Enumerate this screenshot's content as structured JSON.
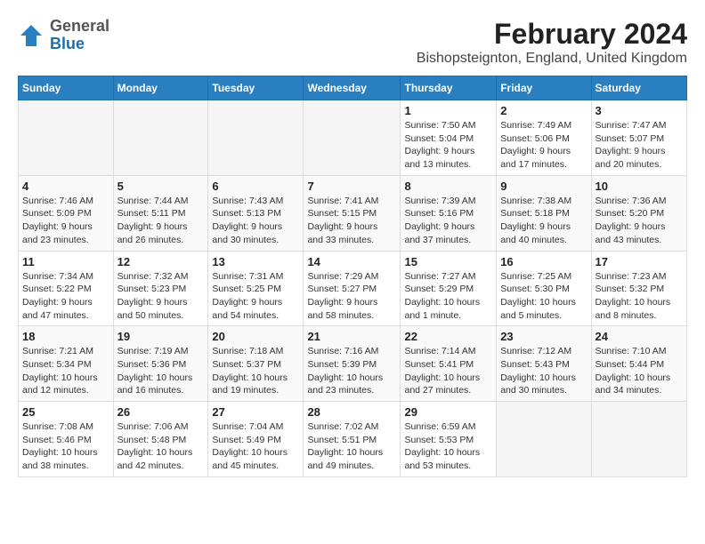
{
  "header": {
    "logo_general": "General",
    "logo_blue": "Blue",
    "month_year": "February 2024",
    "location": "Bishopsteignton, England, United Kingdom"
  },
  "calendar": {
    "days_of_week": [
      "Sunday",
      "Monday",
      "Tuesday",
      "Wednesday",
      "Thursday",
      "Friday",
      "Saturday"
    ],
    "weeks": [
      [
        {
          "day": "",
          "info": ""
        },
        {
          "day": "",
          "info": ""
        },
        {
          "day": "",
          "info": ""
        },
        {
          "day": "",
          "info": ""
        },
        {
          "day": "1",
          "info": "Sunrise: 7:50 AM\nSunset: 5:04 PM\nDaylight: 9 hours\nand 13 minutes."
        },
        {
          "day": "2",
          "info": "Sunrise: 7:49 AM\nSunset: 5:06 PM\nDaylight: 9 hours\nand 17 minutes."
        },
        {
          "day": "3",
          "info": "Sunrise: 7:47 AM\nSunset: 5:07 PM\nDaylight: 9 hours\nand 20 minutes."
        }
      ],
      [
        {
          "day": "4",
          "info": "Sunrise: 7:46 AM\nSunset: 5:09 PM\nDaylight: 9 hours\nand 23 minutes."
        },
        {
          "day": "5",
          "info": "Sunrise: 7:44 AM\nSunset: 5:11 PM\nDaylight: 9 hours\nand 26 minutes."
        },
        {
          "day": "6",
          "info": "Sunrise: 7:43 AM\nSunset: 5:13 PM\nDaylight: 9 hours\nand 30 minutes."
        },
        {
          "day": "7",
          "info": "Sunrise: 7:41 AM\nSunset: 5:15 PM\nDaylight: 9 hours\nand 33 minutes."
        },
        {
          "day": "8",
          "info": "Sunrise: 7:39 AM\nSunset: 5:16 PM\nDaylight: 9 hours\nand 37 minutes."
        },
        {
          "day": "9",
          "info": "Sunrise: 7:38 AM\nSunset: 5:18 PM\nDaylight: 9 hours\nand 40 minutes."
        },
        {
          "day": "10",
          "info": "Sunrise: 7:36 AM\nSunset: 5:20 PM\nDaylight: 9 hours\nand 43 minutes."
        }
      ],
      [
        {
          "day": "11",
          "info": "Sunrise: 7:34 AM\nSunset: 5:22 PM\nDaylight: 9 hours\nand 47 minutes."
        },
        {
          "day": "12",
          "info": "Sunrise: 7:32 AM\nSunset: 5:23 PM\nDaylight: 9 hours\nand 50 minutes."
        },
        {
          "day": "13",
          "info": "Sunrise: 7:31 AM\nSunset: 5:25 PM\nDaylight: 9 hours\nand 54 minutes."
        },
        {
          "day": "14",
          "info": "Sunrise: 7:29 AM\nSunset: 5:27 PM\nDaylight: 9 hours\nand 58 minutes."
        },
        {
          "day": "15",
          "info": "Sunrise: 7:27 AM\nSunset: 5:29 PM\nDaylight: 10 hours\nand 1 minute."
        },
        {
          "day": "16",
          "info": "Sunrise: 7:25 AM\nSunset: 5:30 PM\nDaylight: 10 hours\nand 5 minutes."
        },
        {
          "day": "17",
          "info": "Sunrise: 7:23 AM\nSunset: 5:32 PM\nDaylight: 10 hours\nand 8 minutes."
        }
      ],
      [
        {
          "day": "18",
          "info": "Sunrise: 7:21 AM\nSunset: 5:34 PM\nDaylight: 10 hours\nand 12 minutes."
        },
        {
          "day": "19",
          "info": "Sunrise: 7:19 AM\nSunset: 5:36 PM\nDaylight: 10 hours\nand 16 minutes."
        },
        {
          "day": "20",
          "info": "Sunrise: 7:18 AM\nSunset: 5:37 PM\nDaylight: 10 hours\nand 19 minutes."
        },
        {
          "day": "21",
          "info": "Sunrise: 7:16 AM\nSunset: 5:39 PM\nDaylight: 10 hours\nand 23 minutes."
        },
        {
          "day": "22",
          "info": "Sunrise: 7:14 AM\nSunset: 5:41 PM\nDaylight: 10 hours\nand 27 minutes."
        },
        {
          "day": "23",
          "info": "Sunrise: 7:12 AM\nSunset: 5:43 PM\nDaylight: 10 hours\nand 30 minutes."
        },
        {
          "day": "24",
          "info": "Sunrise: 7:10 AM\nSunset: 5:44 PM\nDaylight: 10 hours\nand 34 minutes."
        }
      ],
      [
        {
          "day": "25",
          "info": "Sunrise: 7:08 AM\nSunset: 5:46 PM\nDaylight: 10 hours\nand 38 minutes."
        },
        {
          "day": "26",
          "info": "Sunrise: 7:06 AM\nSunset: 5:48 PM\nDaylight: 10 hours\nand 42 minutes."
        },
        {
          "day": "27",
          "info": "Sunrise: 7:04 AM\nSunset: 5:49 PM\nDaylight: 10 hours\nand 45 minutes."
        },
        {
          "day": "28",
          "info": "Sunrise: 7:02 AM\nSunset: 5:51 PM\nDaylight: 10 hours\nand 49 minutes."
        },
        {
          "day": "29",
          "info": "Sunrise: 6:59 AM\nSunset: 5:53 PM\nDaylight: 10 hours\nand 53 minutes."
        },
        {
          "day": "",
          "info": ""
        },
        {
          "day": "",
          "info": ""
        }
      ]
    ]
  }
}
